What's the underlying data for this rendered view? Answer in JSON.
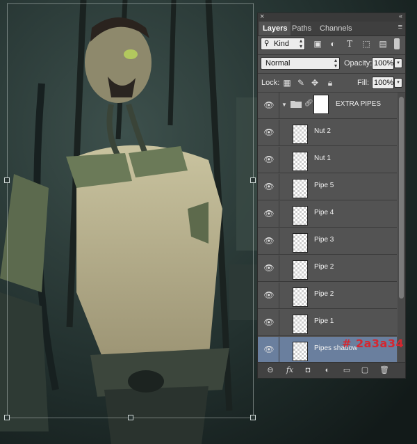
{
  "panel": {
    "close_glyph": "×",
    "collapse_glyph": "«",
    "tabs": [
      {
        "label": "Layers",
        "active": true
      },
      {
        "label": "Paths",
        "active": false
      },
      {
        "label": "Channels",
        "active": false
      }
    ],
    "menu_glyph": "≡",
    "filter": {
      "label": "Kind",
      "icons": [
        "image-filter-icon",
        "adjustment-filter-icon",
        "type-filter-icon",
        "shape-filter-icon",
        "smartobject-filter-icon",
        "filter-toggle-icon"
      ]
    },
    "blend_mode": "Normal",
    "opacity": {
      "label": "Opacity:",
      "value": "100%"
    },
    "lock": {
      "label": "Lock:",
      "icons": [
        "lock-transparent-icon",
        "lock-image-icon",
        "lock-position-icon",
        "lock-all-icon"
      ]
    },
    "fill": {
      "label": "Fill:",
      "value": "100%"
    },
    "layers": [
      {
        "name": "EXTRA PIPES",
        "type": "group",
        "selected": false
      },
      {
        "name": "Nut 2",
        "type": "layer",
        "selected": false
      },
      {
        "name": "Nut 1",
        "type": "layer",
        "selected": false
      },
      {
        "name": "Pipe 5",
        "type": "layer",
        "selected": false
      },
      {
        "name": "Pipe 4",
        "type": "layer",
        "selected": false
      },
      {
        "name": "Pipe 3",
        "type": "layer",
        "selected": false
      },
      {
        "name": "Pipe 2",
        "type": "layer",
        "selected": false
      },
      {
        "name": "Pipe 2",
        "type": "layer",
        "selected": false
      },
      {
        "name": "Pipe 1",
        "type": "layer",
        "selected": false
      },
      {
        "name": "Pipes shadow",
        "type": "layer",
        "selected": true
      }
    ],
    "footer_icons": [
      "link-layers-icon",
      "fx-icon",
      "add-mask-icon",
      "adjustment-layer-icon",
      "new-group-icon",
      "new-layer-icon",
      "trash-icon"
    ],
    "footer_glyphs": [
      "⊖",
      "fx",
      "◘",
      "◐",
      "▭",
      "▢",
      "🗑"
    ]
  },
  "annotation": {
    "hex_color": "# 2a3a34"
  },
  "colors": {
    "panel_bg": "#535353",
    "selected_row": "#6a7f9e",
    "annotation": "#d6262f"
  }
}
